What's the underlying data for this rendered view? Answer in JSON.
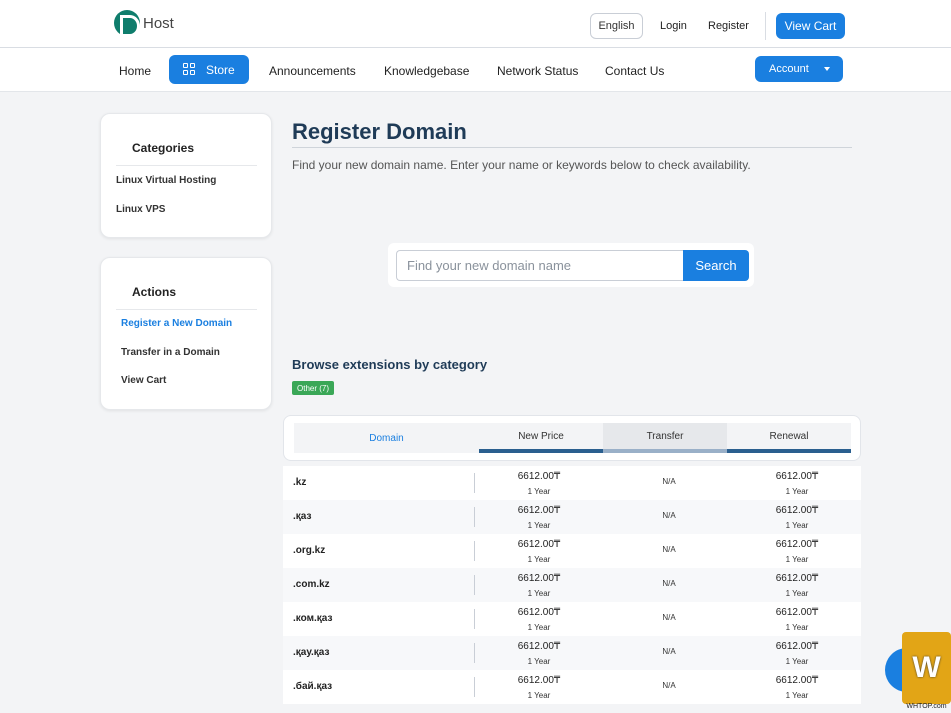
{
  "header": {
    "logo_text": "Host",
    "language": "English",
    "login": "Login",
    "register": "Register",
    "view_cart": "View Cart"
  },
  "nav": {
    "home": "Home",
    "store": "Store",
    "announcements": "Announcements",
    "knowledgebase": "Knowledgebase",
    "network_status": "Network Status",
    "contact_us": "Contact Us",
    "account": "Account"
  },
  "sidebar": {
    "categories_title": "Categories",
    "categories": [
      "Linux Virtual Hosting",
      "Linux VPS"
    ],
    "actions_title": "Actions",
    "actions": [
      "Register a New Domain",
      "Transfer in a Domain",
      "View Cart"
    ]
  },
  "main": {
    "title": "Register Domain",
    "subtitle": "Find your new domain name. Enter your name or keywords below to check availability.",
    "search_placeholder": "Find your new domain name",
    "search_button": "Search",
    "browse_title": "Browse extensions by category",
    "category_tag": "Other (7)"
  },
  "table": {
    "headers": [
      "Domain",
      "New Price",
      "Transfer",
      "Renewal"
    ],
    "rows": [
      {
        "tld": ".kz",
        "new_price": "6612.00₸",
        "new_period": "1 Year",
        "transfer": "N/A",
        "renewal": "6612.00₸",
        "renewal_period": "1 Year"
      },
      {
        "tld": ".қаз",
        "new_price": "6612.00₸",
        "new_period": "1 Year",
        "transfer": "N/A",
        "renewal": "6612.00₸",
        "renewal_period": "1 Year"
      },
      {
        "tld": ".org.kz",
        "new_price": "6612.00₸",
        "new_period": "1 Year",
        "transfer": "N/A",
        "renewal": "6612.00₸",
        "renewal_period": "1 Year"
      },
      {
        "tld": ".com.kz",
        "new_price": "6612.00₸",
        "new_period": "1 Year",
        "transfer": "N/A",
        "renewal": "6612.00₸",
        "renewal_period": "1 Year"
      },
      {
        "tld": ".ком.қаз",
        "new_price": "6612.00₸",
        "new_period": "1 Year",
        "transfer": "N/A",
        "renewal": "6612.00₸",
        "renewal_period": "1 Year"
      },
      {
        "tld": ".қау.қаз",
        "new_price": "6612.00₸",
        "new_period": "1 Year",
        "transfer": "N/A",
        "renewal": "6612.00₸",
        "renewal_period": "1 Year"
      },
      {
        "tld": ".бай.қаз",
        "new_price": "6612.00₸",
        "new_period": "1 Year",
        "transfer": "N/A",
        "renewal": "6612.00₸",
        "renewal_period": "1 Year"
      }
    ]
  },
  "watermark": "WHTOP.com",
  "colors": {
    "accent": "#1a7fe0",
    "tag_green": "#3aa757",
    "title": "#1f3b57"
  }
}
